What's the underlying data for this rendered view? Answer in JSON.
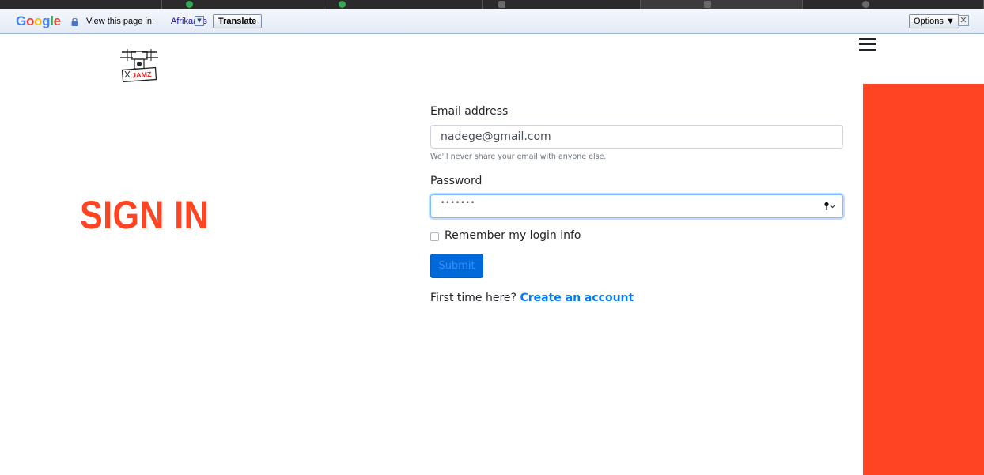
{
  "translate_bar": {
    "brand": "Google",
    "prompt": "View this page in:",
    "language": "Afrikaans",
    "translate_label": "Translate",
    "options_label": "Options ▼",
    "close_glyph": "✕"
  },
  "logo": {
    "badge_text": "JAMZ",
    "icon": "drone-logo-icon"
  },
  "menu": {
    "icon": "hamburger-menu-icon"
  },
  "page": {
    "title": "SIGN IN"
  },
  "form": {
    "email_label": "Email address",
    "email_value": "nadege@gmail.com",
    "email_help": "We'll never share your email with anyone else.",
    "password_label": "Password",
    "password_mask": "•••••••",
    "remember_label": "Remember my login info",
    "submit_label": "Submit",
    "first_time_text": "First time here?",
    "create_account_label": "Create an account"
  },
  "colors": {
    "accent": "#ff4423",
    "primary": "#007bff",
    "submit_bg": "#0069d9"
  }
}
